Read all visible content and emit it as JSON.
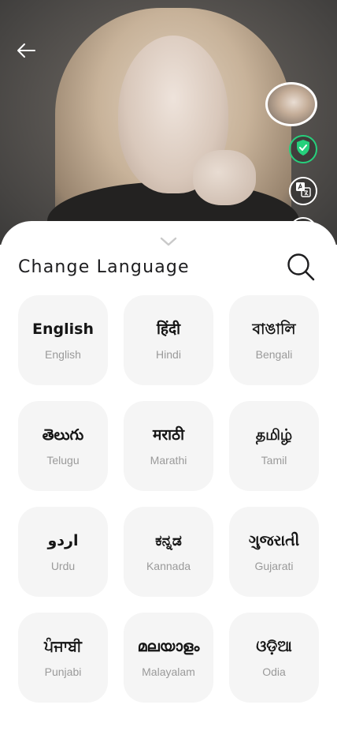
{
  "sheet": {
    "title": "Change Language"
  },
  "icons": {
    "back": "arrow-left-icon",
    "verified": "shield-check-icon",
    "translate": "translate-icon",
    "collapse": "chevron-down-icon",
    "search": "search-icon"
  },
  "colors": {
    "verified_green": "#26d07c",
    "card_background": "#f5f5f5",
    "native_text": "#151515",
    "english_text": "#9a9a9a"
  },
  "languages": [
    {
      "native": "English",
      "english": "English"
    },
    {
      "native": "हिंदी",
      "english": "Hindi"
    },
    {
      "native": "বাঙালি",
      "english": "Bengali"
    },
    {
      "native": "తెలుగు",
      "english": "Telugu"
    },
    {
      "native": "मराठी",
      "english": "Marathi"
    },
    {
      "native": "தமிழ்",
      "english": "Tamil"
    },
    {
      "native": "اردو",
      "english": "Urdu"
    },
    {
      "native": "ಕನ್ನಡ",
      "english": "Kannada"
    },
    {
      "native": "ગુજરાતી",
      "english": "Gujarati"
    },
    {
      "native": "ਪੰਜਾਬੀ",
      "english": "Punjabi"
    },
    {
      "native": "മലയാളം",
      "english": "Malayalam"
    },
    {
      "native": "ଓଡ଼ିଆ",
      "english": "Odia"
    }
  ]
}
